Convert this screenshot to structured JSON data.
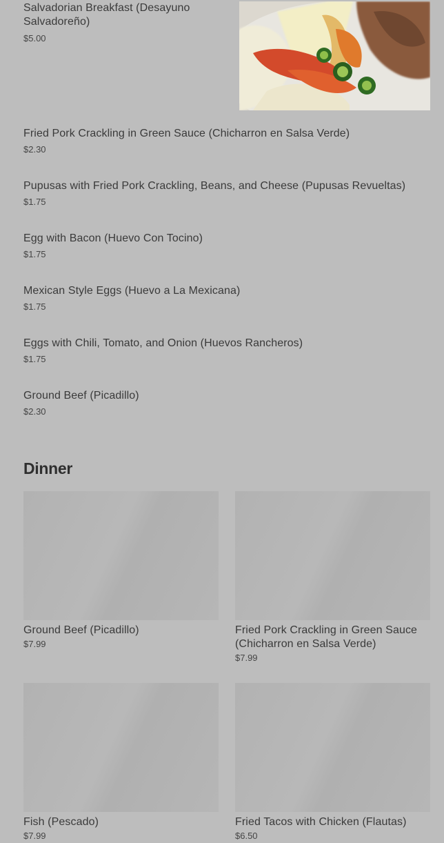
{
  "breakfast": {
    "featured": {
      "name": "Salvadorian Breakfast (Desayuno Salvadoreño)",
      "price": "$5.00",
      "photo_icon": "food-photo"
    },
    "items": [
      {
        "name": "Fried Pork Crackling in Green Sauce (Chicharron en Salsa Verde)",
        "price": "$2.30"
      },
      {
        "name": "Pupusas with Fried Pork Crackling, Beans, and Cheese (Pupusas Revueltas)",
        "price": "$1.75"
      },
      {
        "name": "Egg with Bacon (Huevo Con Tocino)",
        "price": "$1.75"
      },
      {
        "name": "Mexican Style Eggs (Huevo a La Mexicana)",
        "price": "$1.75"
      },
      {
        "name": "Eggs with Chili, Tomato, and Onion (Huevos Rancheros)",
        "price": "$1.75"
      },
      {
        "name": "Ground Beef (Picadillo)",
        "price": "$2.30"
      }
    ]
  },
  "dinner": {
    "heading": "Dinner",
    "cards": [
      {
        "name": "Ground Beef (Picadillo)",
        "price": "$7.99"
      },
      {
        "name": "Fried Pork Crackling in Green Sauce (Chicharron en Salsa Verde)",
        "price": "$7.99"
      },
      {
        "name": "Fish (Pescado)",
        "price": "$7.99"
      },
      {
        "name": "Fried Tacos with Chicken (Flautas)",
        "price": "$6.50"
      }
    ]
  },
  "colors": {
    "page_background": "#bdbdbd",
    "text": "#3a3a3a",
    "image_placeholder": "#b4b4b4"
  }
}
